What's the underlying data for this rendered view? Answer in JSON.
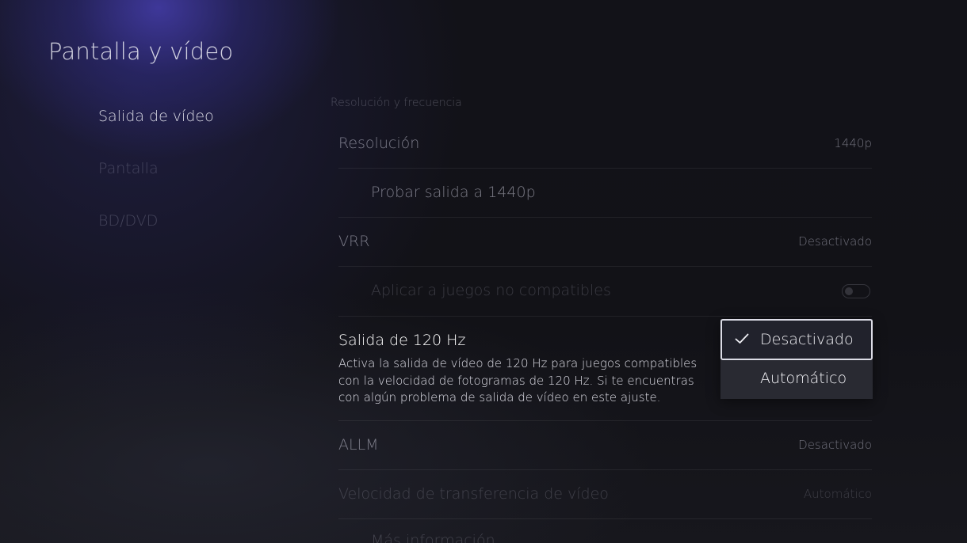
{
  "page": {
    "title": "Pantalla y vídeo"
  },
  "sidebar": {
    "items": [
      {
        "label": "Salida de vídeo"
      },
      {
        "label": "Pantalla"
      },
      {
        "label": "BD/DVD"
      }
    ]
  },
  "main": {
    "section_header": "Resolución y frecuencia",
    "rows": {
      "resolution": {
        "label": "Resolución",
        "value": "1440p"
      },
      "test_output": {
        "label": "Probar salida a 1440p"
      },
      "vrr": {
        "label": "VRR",
        "value": "Desactivado"
      },
      "apply_unsupported": {
        "label": "Aplicar a juegos no compatibles",
        "toggle": "off"
      },
      "hz120": {
        "label": "Salida de 120 Hz",
        "description": "Activa la salida de vídeo de 120 Hz para juegos compatibles con la velocidad de fotogramas de 120 Hz. Si te encuentras con algún problema de salida de vídeo en este ajuste."
      },
      "allm": {
        "label": "ALLM",
        "value": "Desactivado"
      },
      "transfer_rate": {
        "label": "Velocidad de transferencia de vídeo",
        "value": "Automático"
      },
      "more_info": {
        "label": "Más información"
      }
    }
  },
  "dropdown": {
    "options": [
      {
        "label": "Desactivado",
        "selected": true,
        "icon": "check-icon"
      },
      {
        "label": "Automático",
        "selected": false
      }
    ]
  }
}
